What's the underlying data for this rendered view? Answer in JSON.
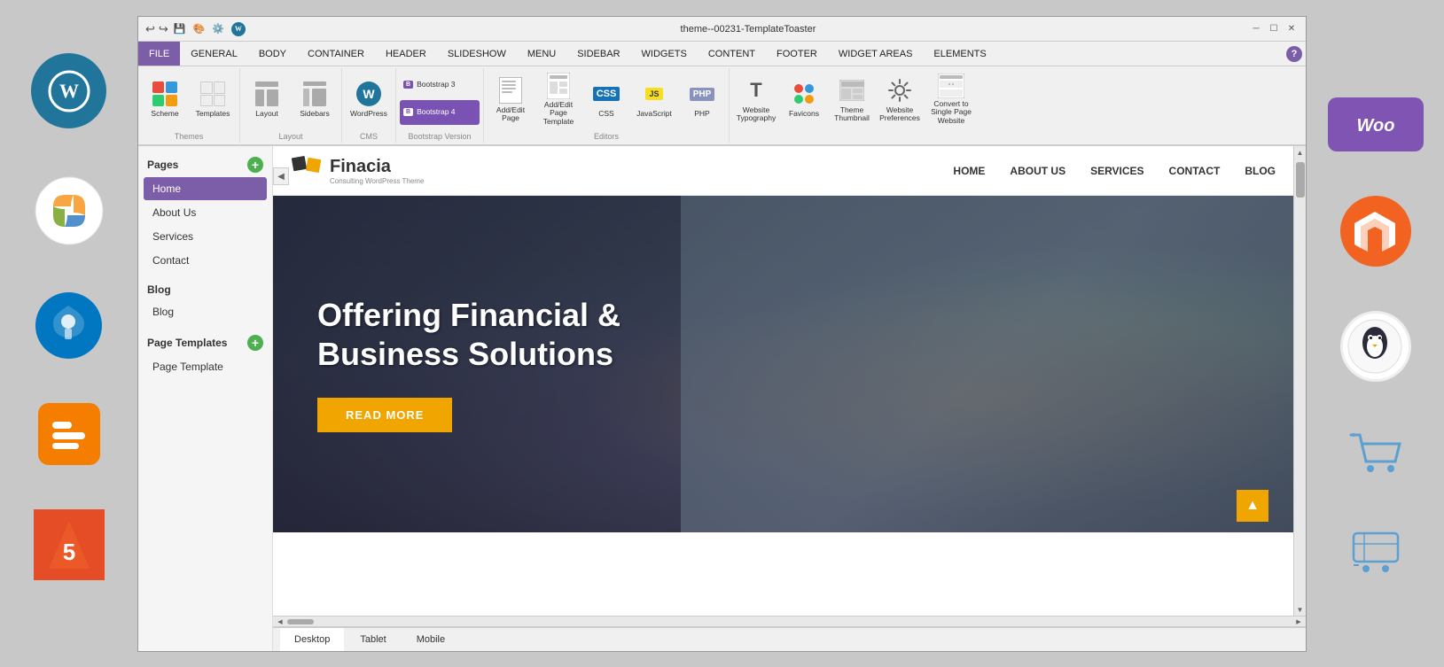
{
  "window": {
    "title": "theme--00231-TemplateToaster",
    "min_btn": "─",
    "max_btn": "☐",
    "close_btn": "✕"
  },
  "toolbar_icons": {
    "undo": "↩",
    "redo": "↪"
  },
  "menu": {
    "items": [
      "FILE",
      "GENERAL",
      "BODY",
      "CONTAINER",
      "HEADER",
      "SLIDESHOW",
      "MENU",
      "SIDEBAR",
      "WIDGETS",
      "CONTENT",
      "FOOTER",
      "WIDGET AREAS",
      "ELEMENTS"
    ]
  },
  "ribbon": {
    "groups": [
      {
        "label": "Themes",
        "buttons": [
          {
            "id": "scheme",
            "label": "Scheme"
          },
          {
            "id": "templates",
            "label": "Templates"
          }
        ]
      },
      {
        "label": "Layout",
        "buttons": [
          {
            "id": "layout",
            "label": "Layout"
          },
          {
            "id": "sidebars",
            "label": "Sidebars"
          }
        ]
      },
      {
        "label": "CMS",
        "buttons": [
          {
            "id": "wordpress",
            "label": "WordPress"
          }
        ]
      },
      {
        "label": "Bootstrap Version",
        "buttons": [
          {
            "id": "bootstrap3",
            "label": "Bootstrap 3"
          },
          {
            "id": "bootstrap4",
            "label": "Bootstrap 4",
            "active": true
          }
        ]
      },
      {
        "label": "Editors",
        "buttons": [
          {
            "id": "add_edit_page",
            "label": "Add/Edit Page"
          },
          {
            "id": "add_edit_page_template",
            "label": "Add/Edit Page Template"
          },
          {
            "id": "css",
            "label": "CSS"
          },
          {
            "id": "javascript",
            "label": "JavaScript"
          },
          {
            "id": "php",
            "label": "PHP"
          }
        ]
      },
      {
        "label": "",
        "buttons": [
          {
            "id": "website_typography",
            "label": "Website Typography"
          },
          {
            "id": "favicons",
            "label": "Favicons"
          },
          {
            "id": "theme_thumbnail",
            "label": "Theme Thumbnail"
          },
          {
            "id": "website_preferences",
            "label": "Website Preferences"
          },
          {
            "id": "convert",
            "label": "Convert to Single Page Website"
          }
        ]
      }
    ]
  },
  "sidebar": {
    "pages_label": "Pages",
    "pages": [
      {
        "id": "home",
        "label": "Home",
        "active": true
      },
      {
        "id": "about",
        "label": "About Us"
      },
      {
        "id": "services",
        "label": "Services"
      },
      {
        "id": "contact",
        "label": "Contact"
      }
    ],
    "blog_label": "Blog",
    "blog_pages": [
      {
        "id": "blog",
        "label": "Blog"
      }
    ],
    "page_templates_label": "Page Templates",
    "page_templates": [
      {
        "id": "page_template",
        "label": "Page Template"
      }
    ]
  },
  "preview": {
    "nav": {
      "logo_name": "Finacia",
      "logo_tagline": "Consulting WordPress Theme",
      "links": [
        "HOME",
        "ABOUT US",
        "SERVICES",
        "CONTACT",
        "BLOG"
      ]
    },
    "hero": {
      "title": "Offering Financial & Business Solutions",
      "cta": "READ MORE"
    }
  },
  "bottom_tabs": {
    "tabs": [
      "Desktop",
      "Tablet",
      "Mobile"
    ],
    "active": "Desktop"
  },
  "left_icons": [
    {
      "id": "wordpress",
      "label": "WordPress"
    },
    {
      "id": "joomla",
      "label": "Joomla"
    },
    {
      "id": "drupal",
      "label": "Drupal"
    },
    {
      "id": "blogger",
      "label": "Blogger"
    },
    {
      "id": "html5",
      "label": "HTML5"
    }
  ],
  "right_icons": [
    {
      "id": "woo",
      "label": "Woo"
    },
    {
      "id": "magento",
      "label": "Magento"
    },
    {
      "id": "bird",
      "label": "OpenCart Bird"
    },
    {
      "id": "cart",
      "label": "Shopping Cart"
    },
    {
      "id": "cart2",
      "label": "Cart 2"
    }
  ]
}
